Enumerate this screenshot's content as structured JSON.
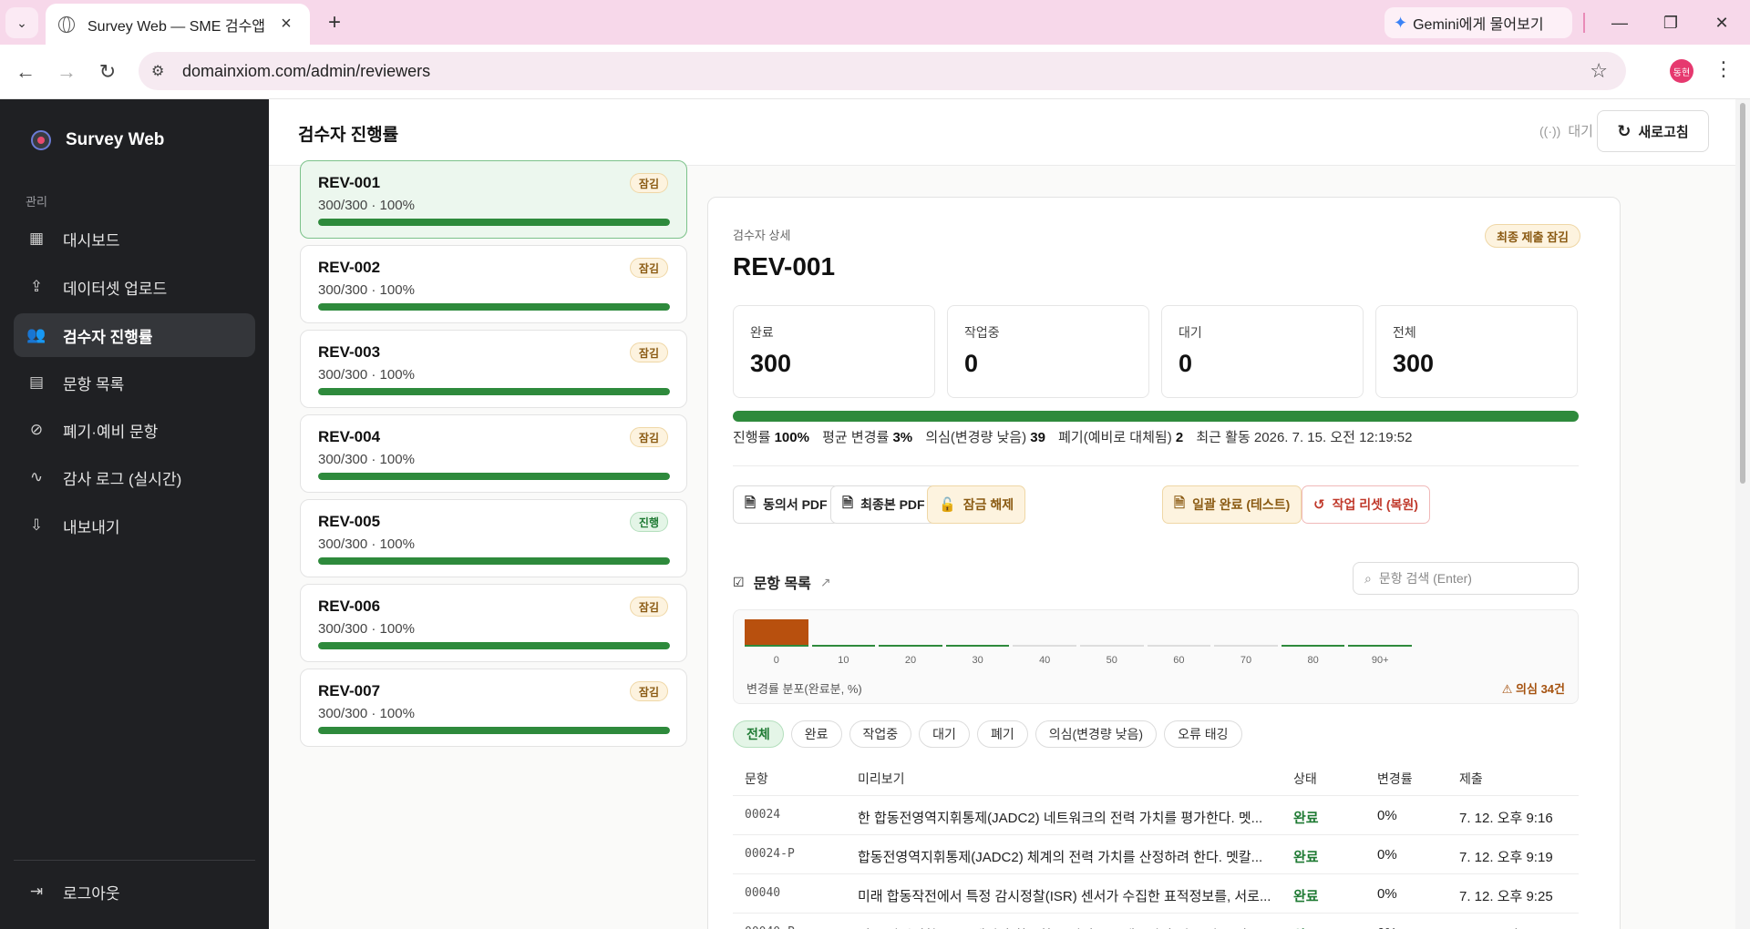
{
  "browser": {
    "tab_title": "Survey Web — SME 검수앱",
    "gemini_label": "Gemini에게 물어보기",
    "url": "domainxiom.com/admin/reviewers",
    "profile_initials": "동현"
  },
  "sidebar": {
    "brand": "Survey Web",
    "section_label": "관리",
    "items": [
      {
        "label": "대시보드",
        "icon": "grid-icon"
      },
      {
        "label": "데이터셋 업로드",
        "icon": "upload-icon"
      },
      {
        "label": "검수자 진행률",
        "icon": "users-icon",
        "active": true
      },
      {
        "label": "문항 목록",
        "icon": "clipboard-icon"
      },
      {
        "label": "폐기·예비 문항",
        "icon": "ban-icon"
      },
      {
        "label": "감사 로그 (실시간)",
        "icon": "activity-icon"
      },
      {
        "label": "내보내기",
        "icon": "download-icon"
      }
    ],
    "logout_label": "로그아웃"
  },
  "header": {
    "title": "검수자 진행률",
    "status": "대기",
    "refresh_label": "새로고침"
  },
  "reviewers": [
    {
      "id": "REV-001",
      "progress": "300/300 · 100%",
      "badge": "잠김",
      "badge_type": "lock",
      "percent": 100,
      "selected": true
    },
    {
      "id": "REV-002",
      "progress": "300/300 · 100%",
      "badge": "잠김",
      "badge_type": "lock",
      "percent": 100
    },
    {
      "id": "REV-003",
      "progress": "300/300 · 100%",
      "badge": "잠김",
      "badge_type": "lock",
      "percent": 100
    },
    {
      "id": "REV-004",
      "progress": "300/300 · 100%",
      "badge": "잠김",
      "badge_type": "lock",
      "percent": 100
    },
    {
      "id": "REV-005",
      "progress": "300/300 · 100%",
      "badge": "진행",
      "badge_type": "progress",
      "percent": 100
    },
    {
      "id": "REV-006",
      "progress": "300/300 · 100%",
      "badge": "잠김",
      "badge_type": "lock",
      "percent": 100
    },
    {
      "id": "REV-007",
      "progress": "300/300 · 100%",
      "badge": "잠김",
      "badge_type": "lock",
      "percent": 100
    }
  ],
  "detail": {
    "label": "검수자 상세",
    "id": "REV-001",
    "final_badge": "최종 제출 잠김",
    "stats": [
      {
        "label": "완료",
        "value": "300"
      },
      {
        "label": "작업중",
        "value": "0"
      },
      {
        "label": "대기",
        "value": "0"
      },
      {
        "label": "전체",
        "value": "300"
      }
    ],
    "progress_percent": 100,
    "summary": {
      "progress_label": "진행률",
      "progress_value": "100%",
      "avg_label": "평균 변경률",
      "avg_value": "3%",
      "suspect_label": "의심(변경량 낮음)",
      "suspect_value": "39",
      "discard_label": "폐기(예비로 대체됨)",
      "discard_value": "2",
      "recent_label": "최근 활동",
      "recent_value": "2026. 7. 15. 오전 12:19:52"
    },
    "buttons": {
      "consent_pdf": "동의서 PDF",
      "final_pdf": "최종본 PDF",
      "unlock": "잠금 해제",
      "bulk_complete": "일괄 완료 (테스트)",
      "reset": "작업 리셋 (복원)"
    }
  },
  "items": {
    "title": "문항 목록",
    "search_placeholder": "문항 검색 (Enter)",
    "distribution": {
      "caption": "변경률 분포(완료분, %)",
      "warning": "의심 34건",
      "bins": [
        "0",
        "10",
        "20",
        "30",
        "40",
        "50",
        "60",
        "70",
        "80",
        "90+"
      ],
      "counts_relative": [
        1.0,
        0.02,
        0.02,
        0.02,
        0.0,
        0.0,
        0.0,
        0.0,
        0.02,
        0.02
      ]
    },
    "filters": [
      "전체",
      "완료",
      "작업중",
      "대기",
      "폐기",
      "의심(변경량 낮음)",
      "오류 태깅"
    ],
    "columns": {
      "id": "문항",
      "preview": "미리보기",
      "status": "상태",
      "rate": "변경률",
      "submitted": "제출"
    },
    "rows": [
      {
        "id": "00024",
        "preview": "한 합동전영역지휘통제(JADC2) 네트워크의 전력 가치를 평가한다. 멧...",
        "status": "완료",
        "rate": "0%",
        "submitted": "7. 12. 오후 9:16"
      },
      {
        "id": "00024-P",
        "preview": "합동전영역지휘통제(JADC2) 체계의 전력 가치를 산정하려 한다. 멧칼...",
        "status": "완료",
        "rate": "0%",
        "submitted": "7. 12. 오후 9:19"
      },
      {
        "id": "00040",
        "preview": "미래 합동작전에서 특정 감시정찰(ISR) 센서가 수집한 표적정보를, 서로...",
        "status": "완료",
        "rate": "0%",
        "submitted": "7. 12. 오후 9:25"
      },
      {
        "id": "00040-P",
        "preview": "어느 감시정찰(ISR) 센서가 확보한 표적정보를 제주사가 서로 다른 여...",
        "status": "완료",
        "rate": "0%",
        "submitted": "7. 12. 오후 9:26"
      }
    ]
  }
}
